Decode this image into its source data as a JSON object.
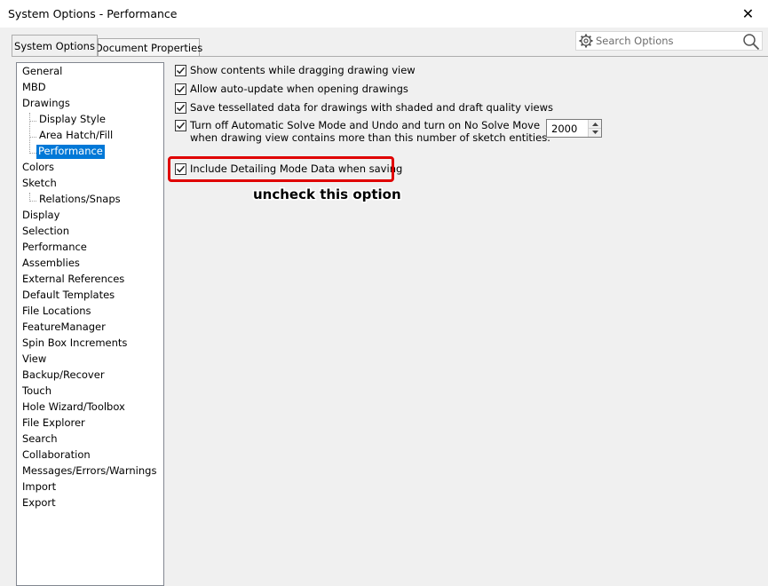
{
  "window": {
    "title": "System Options - Performance",
    "close_glyph": "✕"
  },
  "tabs": [
    {
      "label": "System Options",
      "active": true
    },
    {
      "label": "Document Properties",
      "active": false
    }
  ],
  "search": {
    "placeholder": "Search Options",
    "icons": [
      "gear-icon",
      "search-icon"
    ]
  },
  "tree": {
    "items": [
      {
        "label": "General"
      },
      {
        "label": "MBD"
      },
      {
        "label": "Drawings"
      },
      {
        "label": "Display Style"
      },
      {
        "label": "Area Hatch/Fill"
      },
      {
        "label": "Performance",
        "selected": true
      },
      {
        "label": "Colors"
      },
      {
        "label": "Sketch"
      },
      {
        "label": "Relations/Snaps"
      },
      {
        "label": "Display"
      },
      {
        "label": "Selection"
      },
      {
        "label": "Performance"
      },
      {
        "label": "Assemblies"
      },
      {
        "label": "External References"
      },
      {
        "label": "Default Templates"
      },
      {
        "label": "File Locations"
      },
      {
        "label": "FeatureManager"
      },
      {
        "label": "Spin Box Increments"
      },
      {
        "label": "View"
      },
      {
        "label": "Backup/Recover"
      },
      {
        "label": "Touch"
      },
      {
        "label": "Hole Wizard/Toolbox"
      },
      {
        "label": "File Explorer"
      },
      {
        "label": "Search"
      },
      {
        "label": "Collaboration"
      },
      {
        "label": "Messages/Errors/Warnings"
      },
      {
        "label": "Import"
      },
      {
        "label": "Export"
      }
    ]
  },
  "options": [
    {
      "line1": "Show contents while dragging drawing view",
      "checked": true
    },
    {
      "line1": "Allow auto-update when opening drawings",
      "checked": true
    },
    {
      "line1": "Save tessellated data for drawings with shaded and draft quality views",
      "checked": true
    },
    {
      "line1": "Turn off Automatic Solve Mode and Undo and turn on No Solve Move",
      "line2": "when drawing view contains more than this number of sketch entities:",
      "checked": true
    },
    {
      "line1": "Include Detailing Mode Data when saving",
      "checked": true
    }
  ],
  "sketch_entities_limit": "2000",
  "annotation": {
    "text": "uncheck this option",
    "highlight_color": "#e00000"
  },
  "colors": {
    "selection": "#0078d7"
  }
}
